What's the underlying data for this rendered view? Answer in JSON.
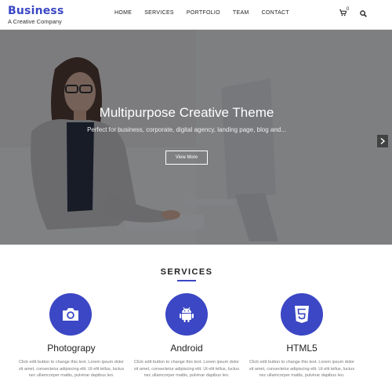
{
  "brand": {
    "title": "Business",
    "tagline": "A Creative Company"
  },
  "nav": {
    "items": [
      "HOME",
      "SERVICES",
      "PORTFOLIO",
      "TEAM",
      "CONTACT"
    ]
  },
  "cart": {
    "count": "0"
  },
  "hero": {
    "title": "Multipurpose Creative Theme",
    "subtitle": "Perfect for business, corporate, digital agency, landing page, blog and...",
    "button_label": "View More"
  },
  "services": {
    "heading": "SERVICES",
    "items": [
      {
        "icon": "camera-icon",
        "title": "Photograpy",
        "text": "Click edit button to change this text. Lorem ipsum dolor sit amet, consectetur adipiscing elit. Ut elit tellus, luctus nec ullamcorper mattis, pulvinar dapibus leo."
      },
      {
        "icon": "android-icon",
        "title": "Android",
        "text": "Click edit button to change this text. Lorem ipsum dolor sit amet, consectetur adipiscing elit. Ut elit tellus, luctus nec ullamcorper mattis, pulvinar dapibus leo."
      },
      {
        "icon": "html5-icon",
        "title": "HTML5",
        "text": "Click edit button to change this text. Lorem ipsum dolor sit amet, consectetur adipiscing elit. Ut elit tellus, luctus nec ullamcorper mattis, pulvinar dapibus leo."
      }
    ]
  },
  "colors": {
    "accent": "#3b47c4",
    "hero_overlay": "#14161a"
  }
}
